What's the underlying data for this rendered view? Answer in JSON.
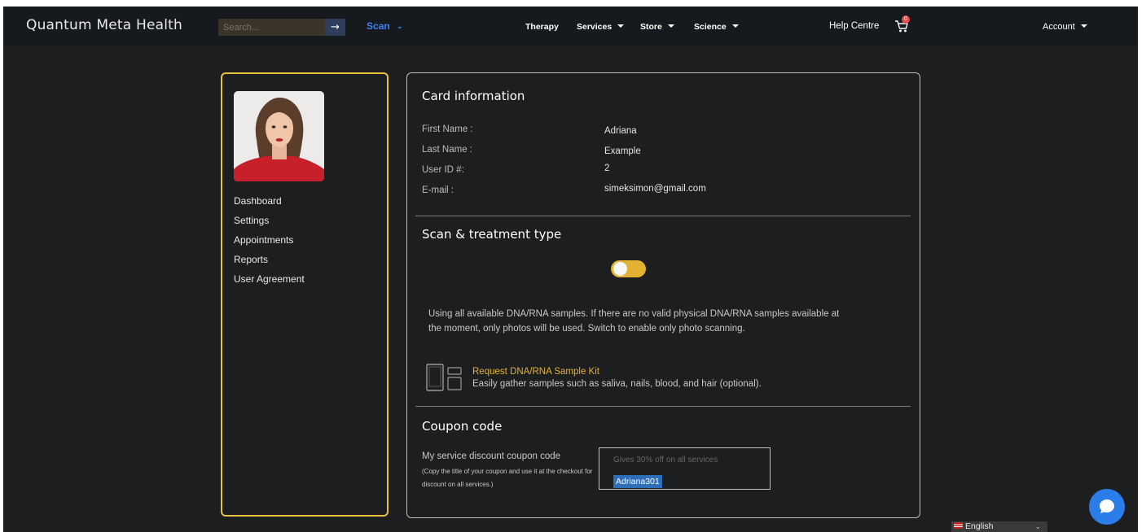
{
  "brand": {
    "logo_text": "Quantum Meta Health"
  },
  "nav": {
    "search_placeholder": "Search...",
    "search_icon": "arrow-right-icon",
    "scan_label": "Scan",
    "links": [
      "Therapy",
      "Services",
      "Store",
      "Science"
    ],
    "help_label": "Help Centre",
    "cart_icon": "cart-icon",
    "cart_count": "0",
    "account_label": "Account"
  },
  "sidebar": {
    "avatar_icon": "profile-photo",
    "items": [
      "Dashboard",
      "Settings",
      "Appointments",
      "Reports",
      "User Agreement"
    ]
  },
  "card": {
    "title": "Card information",
    "first_name_label": "First Name :",
    "first_name": "Adriana",
    "last_name_label": "Last Name :",
    "last_name": "Example",
    "user_id_label": "User ID #:",
    "user_id": "2",
    "email_label": "E-mail :",
    "email": "simeksimon@gmail.com"
  },
  "scan": {
    "title": "Scan & treatment type",
    "toggle_on": false,
    "description": "Using all available DNA/RNA samples. If there are no valid physical DNA/RNA samples available at the moment, only photos will be used. Switch to enable only photo scanning.",
    "kit_link": "Request DNA/RNA Sample Kit",
    "kit_description": "Easily gather samples such as saliva, nails, blood, and hair (optional)."
  },
  "coupon": {
    "title": "Coupon code",
    "label": "My service discount coupon code",
    "note": "(Copy the title of your coupon and use it at the checkout for discount on all services.)",
    "hint": "Gives 30% off on all services",
    "code": "Adriana301"
  },
  "language": {
    "selected": "English"
  },
  "colors": {
    "accent": "#e3b233",
    "link_blue": "#3b82f6",
    "chat_blue": "#2b7de9",
    "background": "#1d1e1f"
  }
}
